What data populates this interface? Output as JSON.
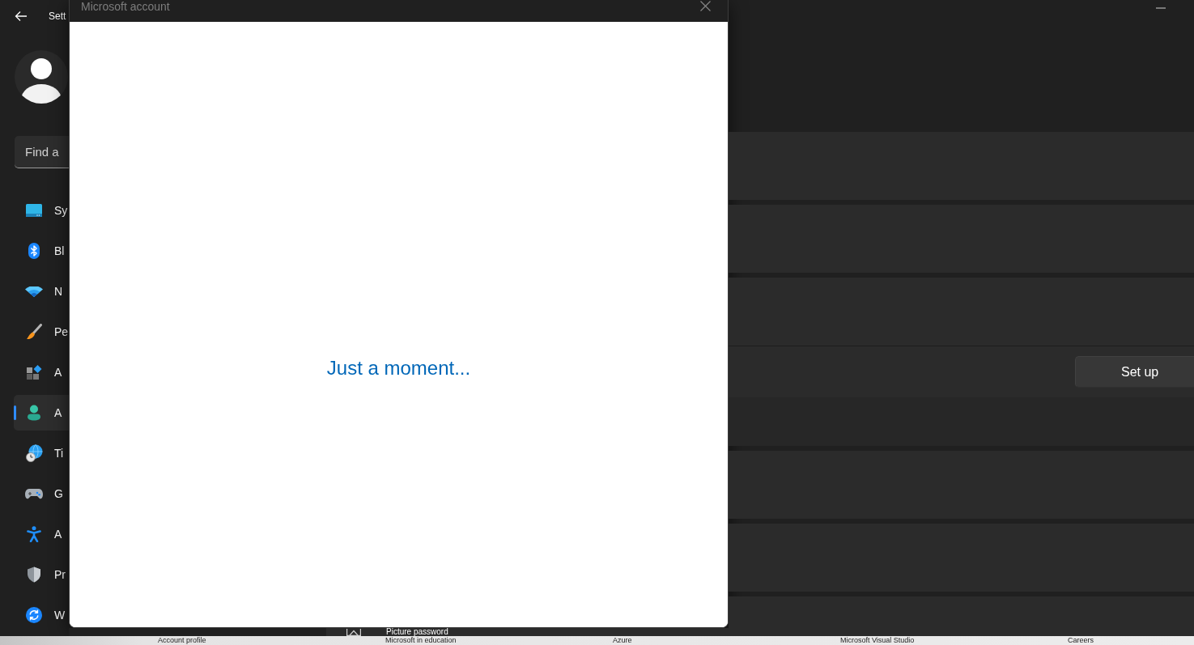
{
  "settings_window": {
    "title": "Sett",
    "search": {
      "placeholder": "Find a"
    },
    "nav_items": [
      {
        "label": "Sy",
        "selected": false
      },
      {
        "label": "Bl",
        "selected": false
      },
      {
        "label": "N",
        "selected": false
      },
      {
        "label": "Pe",
        "selected": false
      },
      {
        "label": "A",
        "selected": false
      },
      {
        "label": "A",
        "selected": true
      },
      {
        "label": "Ti",
        "selected": false
      },
      {
        "label": "G",
        "selected": false
      },
      {
        "label": "A",
        "selected": false
      },
      {
        "label": "Pr",
        "selected": false
      },
      {
        "label": "W",
        "selected": false
      }
    ],
    "setup_button": {
      "label": "Set up"
    },
    "partial_row": {
      "title": "Picture password"
    }
  },
  "dialog": {
    "title": "Microsoft account",
    "message": "Just a moment..."
  },
  "browser_page": {
    "links": [
      "Account profile",
      "Microsoft in education",
      "Azure",
      "Microsoft Visual Studio",
      "Careers"
    ]
  }
}
